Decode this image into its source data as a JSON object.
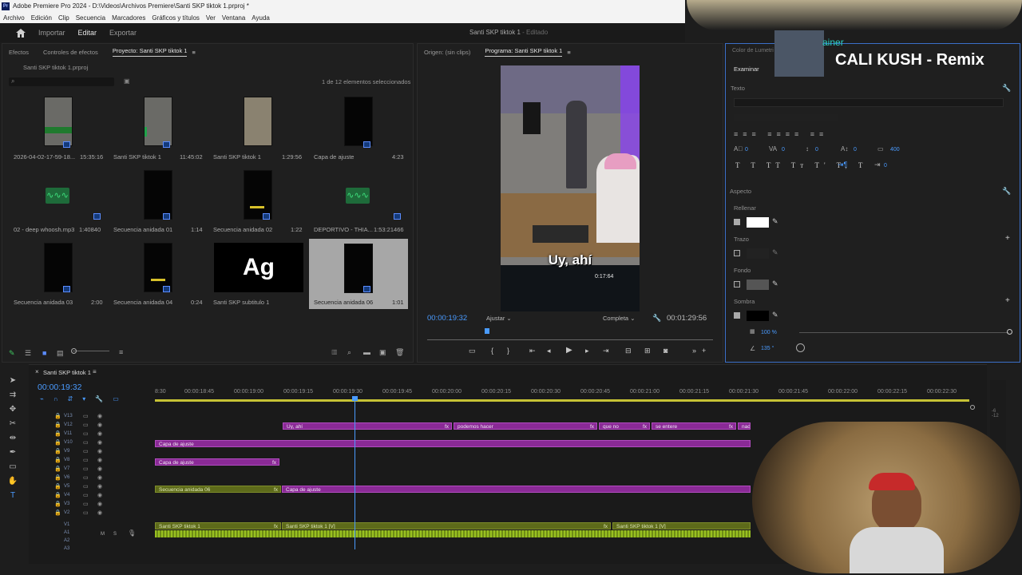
{
  "window": {
    "title": "Adobe Premiere Pro 2024 - D:\\Videos\\Archivos Premiere\\Santi SKP tiktok 1.prproj *"
  },
  "menu": [
    "Archivo",
    "Edición",
    "Clip",
    "Secuencia",
    "Marcadores",
    "Gráficos y títulos",
    "Ver",
    "Ventana",
    "Ayuda"
  ],
  "header": {
    "nav": [
      "Importar",
      "Editar",
      "Exportar"
    ],
    "active": "Editar",
    "project": "Santi SKP tiktok 1",
    "status": "- Editado"
  },
  "project_panel": {
    "tabs": [
      "Efectos",
      "Controles de efectos",
      "Proyecto: Santi SKP tiktok 1"
    ],
    "file": "Santi SKP tiktok 1.prproj",
    "selection": "1 de 12 elementos seleccionados",
    "items": [
      {
        "name": "2026-04-02-17-59-18...",
        "dur": "15:35:16"
      },
      {
        "name": "Santi SKP tiktok 1",
        "dur": "11:45:02"
      },
      {
        "name": "Santi SKP tiktok 1",
        "dur": "1:29:56"
      },
      {
        "name": "Capa de ajuste",
        "dur": "4:23"
      },
      {
        "name": "02 - deep whoosh.mp3",
        "dur": "1:40840"
      },
      {
        "name": "Secuencia anidada 01",
        "dur": "1:14"
      },
      {
        "name": "Secuencia anidada 02",
        "dur": "1:22"
      },
      {
        "name": "DEPORTIVO - THIA...",
        "dur": "1:53:21466"
      },
      {
        "name": "Secuencia anidada 03",
        "dur": "2:00"
      },
      {
        "name": "Secuencia anidada 04",
        "dur": "0:24"
      },
      {
        "name": "Santi SKP subtitulo 1",
        "dur": ""
      },
      {
        "name": "Secuencia anidada 06",
        "dur": "1:01"
      }
    ],
    "ag_text": "Ag"
  },
  "program": {
    "tabs": [
      "Origen: (sin clips)",
      "Programa: Santi SKP tiktok 1"
    ],
    "timecode": "00:00:19:32",
    "fit": "Ajustar",
    "quality": "Completa",
    "duration": "00:01:29:56",
    "caption": "Uy, ahí",
    "screen_time": "0:17:64"
  },
  "essential": {
    "search_tab": "Examinar",
    "color_lbl": "Color de Lumetri",
    "texto": "Texto",
    "aspecto": "Aspecto",
    "rellenar": "Rellenar",
    "trazo": "Trazo",
    "fondo": "Fondo",
    "sombra": "Sombra",
    "num0": "0",
    "num400": "400",
    "opacity": "100 %",
    "angle": "135 °",
    "fill_color": "#ffffff",
    "shadow_color": "#000000",
    "text_styles": [
      "T",
      "T",
      "TT",
      "Tт",
      "T'",
      "T,",
      "T"
    ]
  },
  "overlay": {
    "title": "CALI KUSH - Remix",
    "prefix": "ainer"
  },
  "timeline": {
    "seq_tab": "Santi SKP tiktok 1",
    "timecode": "00:00:19:32",
    "ruler": [
      "8:30",
      "00:00:18:45",
      "00:00:19:00",
      "00:00:19:15",
      "00:00:19:30",
      "00:00:19:45",
      "00:00:20:00",
      "00:00:20:15",
      "00:00:20:30",
      "00:00:20:45",
      "00:00:21:00",
      "00:00:21:15",
      "00:00:21:30",
      "00:00:21:45",
      "00:00:22:00",
      "00:00:22:15",
      "00:00:22:30"
    ],
    "tracks": [
      "V13",
      "V12",
      "V11",
      "V10",
      "V9",
      "V8",
      "V7",
      "V6",
      "V5",
      "V4",
      "V3",
      "V2",
      "V1",
      "A1",
      "A2",
      "A3"
    ],
    "clips": {
      "c1": "Uy, ahí",
      "c2": "podemos hacer",
      "c3": "que no",
      "c4": "se entere",
      "c5": "nad",
      "c6": "Capa de ajuste",
      "c7": "Capa de ajuste",
      "c8": "Secuencia anidada 06",
      "c9": "Capa de ajuste",
      "c10": "Santi SKP tiktok 1",
      "c11": "Santi SKP tiktok 1 [V]",
      "c12": "Santi SKP tiktok 1 [V]"
    },
    "fx": "fx",
    "ms": [
      "M",
      "S"
    ],
    "level": [
      "-6",
      "-12"
    ]
  }
}
